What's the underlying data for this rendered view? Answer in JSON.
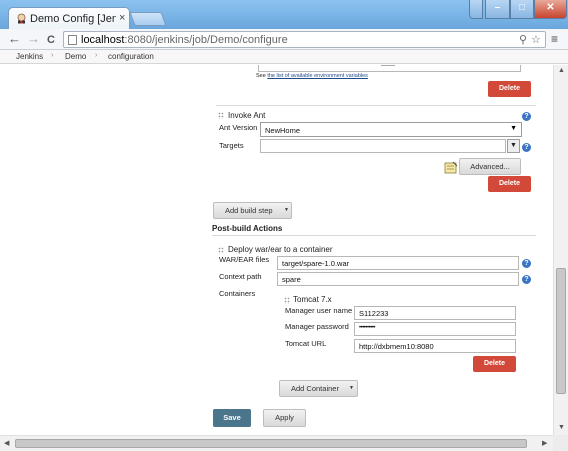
{
  "browser": {
    "tab_title": "Demo Config [Jenkins]",
    "tab_close": "×",
    "url_host": "localhost",
    "url_path": ":8080/jenkins/job/Demo/configure",
    "nav_back": "←",
    "nav_forward": "→",
    "nav_reload": "C",
    "menu_glyph": "≡"
  },
  "breadcrumb": {
    "items": [
      "Jenkins",
      "Demo",
      "configuration"
    ],
    "separator": "›"
  },
  "env_vars": {
    "prefix": "See",
    "link_text": "the list of available environment variables"
  },
  "delete_label": "Delete",
  "invoke_ant": {
    "title": "Invoke Ant",
    "ant_version_label": "Ant Version",
    "ant_version_value": "NewHome",
    "targets_label": "Targets",
    "targets_value": "",
    "advanced_label": "Advanced..."
  },
  "add_build_step_label": "Add build step",
  "post_build_title": "Post-build Actions",
  "deploy": {
    "title": "Deploy war/ear to a container",
    "war_label": "WAR/EAR files",
    "war_value": "target/spare-1.0.war",
    "context_label": "Context path",
    "context_value": "spare",
    "containers_label": "Containers"
  },
  "tomcat": {
    "title": "Tomcat 7.x",
    "user_label": "Manager user name",
    "user_value": "S112233",
    "password_label": "Manager password",
    "password_value": "••••••••••",
    "url_label": "Tomcat URL",
    "url_value": "http://dxbmem10:8080"
  },
  "add_container_label": "Add Container",
  "footer": {
    "save_label": "Save",
    "apply_label": "Apply"
  },
  "colors": {
    "delete_red": "#d24939",
    "save_blue": "#4b758b",
    "help_blue": "#3a74c4"
  }
}
